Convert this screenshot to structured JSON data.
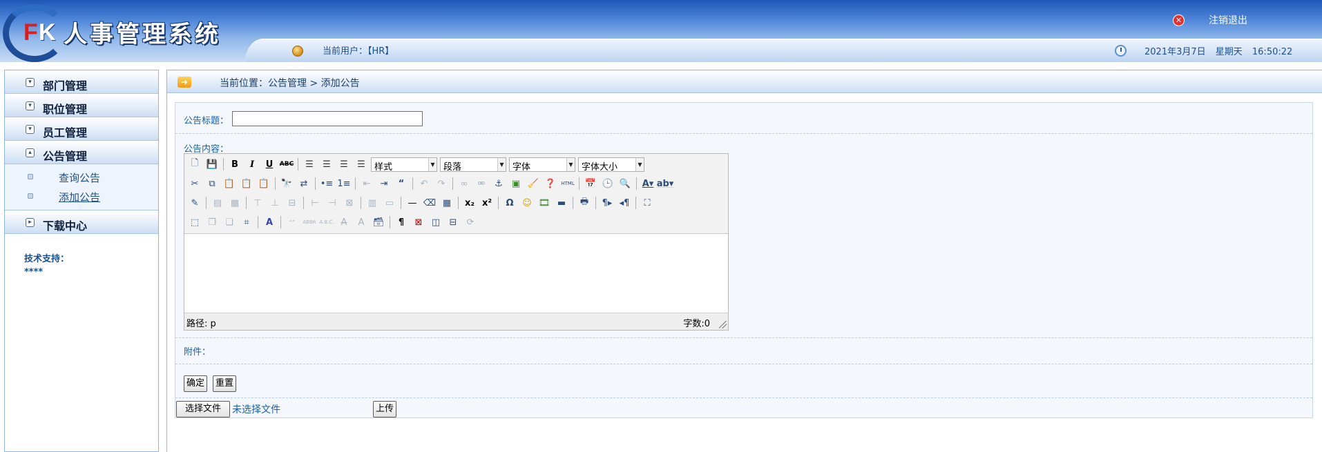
{
  "header": {
    "logo": {
      "f": "F",
      "k": "K"
    },
    "app_title": "人事管理系统",
    "logout_icon": "close-circle-icon",
    "logout_label": "注销退出",
    "current_user": "当前用户：【HR】",
    "datetime": "2021年3月7日 星期天 16:50:22"
  },
  "sidebar": {
    "menus": [
      {
        "label": "部门管理",
        "expanded": false
      },
      {
        "label": "职位管理",
        "expanded": false
      },
      {
        "label": "员工管理",
        "expanded": false
      },
      {
        "label": "公告管理",
        "expanded": true,
        "items": [
          {
            "label": "查询公告",
            "active": false
          },
          {
            "label": "添加公告",
            "active": true
          }
        ]
      },
      {
        "label": "下载中心",
        "expanded": false
      }
    ],
    "tech_support_label": "技术支持：",
    "tech_support_value": "****"
  },
  "breadcrumb": "当前位置：公告管理 > 添加公告",
  "form": {
    "title_label": "公告标题：",
    "title_value": "",
    "content_label": "公告内容：",
    "editor": {
      "style_select": "样式",
      "paragraph_select": "段落",
      "font_select": "字体",
      "fontsize_select": "字体大小",
      "path_label": "路径: p",
      "word_count": "字数:0"
    },
    "attachment_label": "附件：",
    "confirm_button": "确定",
    "reset_button": "重置",
    "choose_file_button": "选择文件",
    "file_status": "未选择文件",
    "upload_button": "上传"
  },
  "colors": {
    "header_blue": "#1f56b8",
    "link_blue": "#1c5fa6",
    "logo_red": "#d62020"
  }
}
